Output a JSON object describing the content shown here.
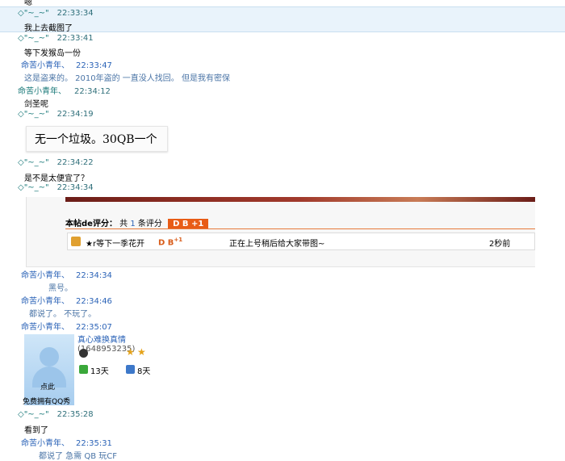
{
  "colors": {
    "selected_bg": "#e9f3fb",
    "peer_name": "#1b7a7a",
    "me_name": "#2b63b7",
    "rating_badge": "#e85c16"
  },
  "top_partial": "嗯",
  "messages": [
    {
      "name": "◇\"~_~\"",
      "time": "22:33:34",
      "text": "我上去截图了"
    },
    {
      "name": "◇\"~_~\"",
      "time": "22:33:41",
      "text": "等下发猴岛一份"
    },
    {
      "name": "命苦小青年、",
      "time": "22:33:47",
      "text": "这是盗来的。 2010年盗的 一直没人找回。 但是我有密保"
    },
    {
      "name": "命苦小青年、",
      "time": "22:34:12",
      "text": "剑圣呢"
    },
    {
      "name": "◇\"~_~\"",
      "time": "22:34:19",
      "text": "无一个垃圾。30QB一个"
    },
    {
      "name": "◇\"~_~\"",
      "time": "22:34:22",
      "text": "是不是太便宜了？"
    },
    {
      "name": "◇\"~_~\"",
      "time": "22:34:34",
      "text": ""
    },
    {
      "name": "命苦小青年、",
      "time": "22:34:34",
      "text": "黑号。"
    },
    {
      "name": "命苦小青年、",
      "time": "22:34:46",
      "text": "都说了。 不玩了。"
    },
    {
      "name": "命苦小青年、",
      "time": "22:35:07",
      "text": ""
    },
    {
      "name": "◇\"~_~\"",
      "time": "22:35:28",
      "text": "看到了"
    },
    {
      "name": "命苦小青年、",
      "time": "22:35:31",
      "text": "都说了 急需 QB  玩CF"
    }
  ],
  "screenshot": {
    "rating_title": "本帖de评分：",
    "rating_total_prefix": "共",
    "rating_total_count": "1",
    "rating_total_suffix": "条评分",
    "rating_badge": "D B +1",
    "row_user": "★r等下一季花开",
    "row_score": "D B",
    "row_score_sup": "+1",
    "row_reason": "正在上号稍后给大家带图~",
    "row_time": "2秒前"
  },
  "profile_card": {
    "name": "真心难换真情",
    "qq": "(1648953235)",
    "online_days": "13天",
    "other_days": "8天",
    "avatar_line1": "点此",
    "avatar_line2": "免费拥有QQ秀"
  }
}
